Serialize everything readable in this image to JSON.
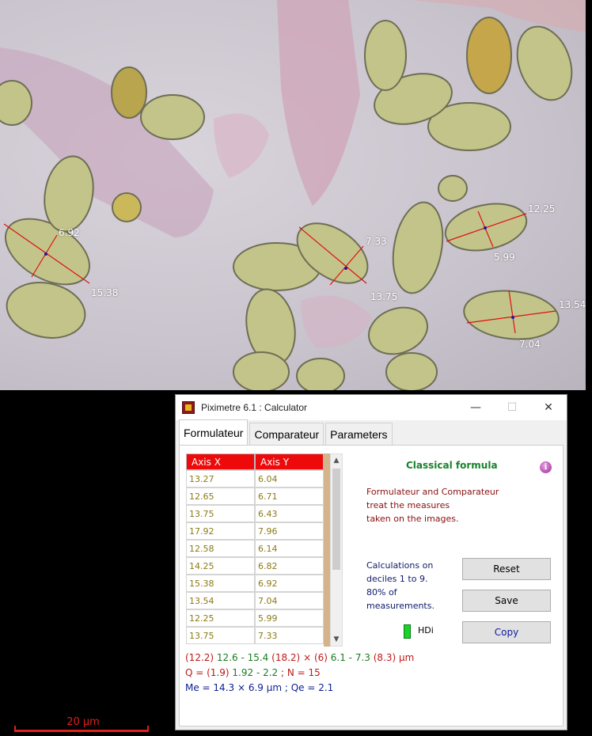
{
  "micrograph": {
    "measurements": [
      "6.92",
      "15.38",
      "7.33",
      "13.75",
      "12.25",
      "5.99",
      "13.54",
      "7.04"
    ]
  },
  "scale_bar": {
    "label": "20 µm"
  },
  "window": {
    "title": "Piximetre 6.1 : Calculator",
    "controls": {
      "minimize": "—",
      "maximize": "☐",
      "close": "✕"
    },
    "tabs": [
      "Formulateur",
      "Comparateur",
      "Parameters"
    ],
    "active_tab": "Formulateur"
  },
  "table": {
    "headers": [
      "Axis X",
      "Axis Y"
    ],
    "rows": [
      [
        "13.27",
        "6.04"
      ],
      [
        "12.65",
        "6.71"
      ],
      [
        "13.75",
        "6.43"
      ],
      [
        "17.92",
        "7.96"
      ],
      [
        "12.58",
        "6.14"
      ],
      [
        "14.25",
        "6.82"
      ],
      [
        "15.38",
        "6.92"
      ],
      [
        "13.54",
        "7.04"
      ],
      [
        "12.25",
        "5.99"
      ],
      [
        "13.75",
        "7.33"
      ]
    ]
  },
  "formula": {
    "title": "Classical formula",
    "info_icon": "i",
    "description": [
      "Formulateur and Comparateur",
      "treat the measures",
      "taken on the images."
    ],
    "calc_note": [
      "Calculations on",
      "deciles 1 to 9.",
      "80% of",
      "measurements."
    ]
  },
  "buttons": {
    "reset": "Reset",
    "save": "Save",
    "copy": "Copy"
  },
  "hdi": {
    "label": "HDi",
    "led_color": "#17d428"
  },
  "results": {
    "line1": {
      "a": "(12.2)",
      "b": "12.6 - 15.4",
      "c": "(18.2)",
      "d": "× (6)",
      "e": "6.1 - 7.3",
      "f": "(8.3)",
      "g": "µm"
    },
    "line2": {
      "a": "Q = (1.9)",
      "b": "1.92 - 2.2",
      "c": "; N = 15"
    },
    "line3": "Me = 14.3 × 6.9 µm ; Qe = 2.1"
  },
  "colors": {
    "header_red": "#ee0a0a",
    "value_olive": "#8a7a16",
    "formula_green": "#18822a",
    "dark_red": "#8a1010",
    "navy": "#0f2090"
  }
}
